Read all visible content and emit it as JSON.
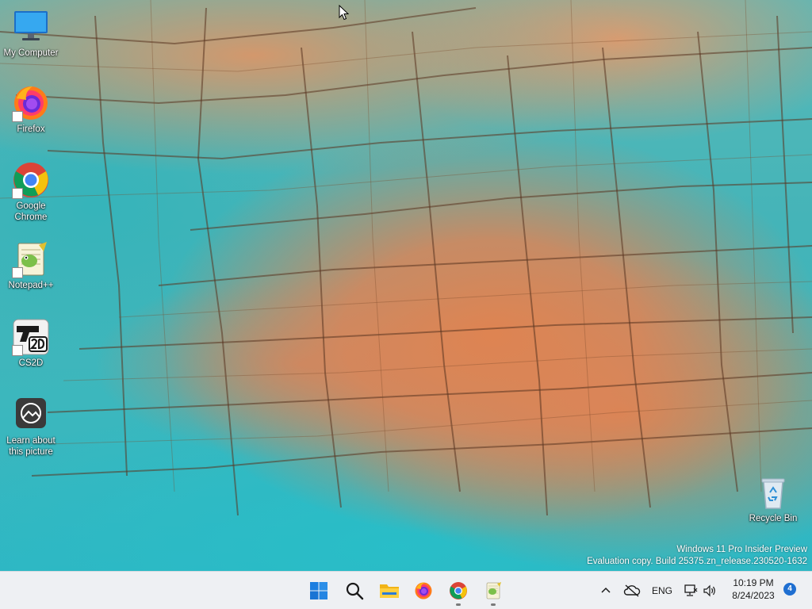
{
  "desktop": {
    "icons": [
      {
        "label": "My Computer"
      },
      {
        "label": "Firefox"
      },
      {
        "label": "Google\nChrome"
      },
      {
        "label": "Notepad++"
      },
      {
        "label": "CS2D"
      },
      {
        "label": "Learn about\nthis picture"
      },
      {
        "label": "Recycle Bin"
      }
    ],
    "watermark": {
      "line1": "Windows 11 Pro Insider Preview",
      "line2": "Evaluation copy. Build 25375.zn_release.230520-1632"
    }
  },
  "taskbar": {
    "apps": [
      {
        "icon": "windows-start-icon"
      },
      {
        "icon": "search-icon"
      },
      {
        "icon": "file-explorer-icon"
      },
      {
        "icon": "firefox-icon"
      },
      {
        "icon": "chrome-icon"
      },
      {
        "icon": "notepadpp-icon"
      }
    ],
    "tray": {
      "language": "ENG",
      "time": "10:19 PM",
      "date": "8/24/2023",
      "notification_count": "4"
    }
  },
  "colors": {
    "taskbar_bg": "#eef0f3",
    "accent": "#1f6fd1",
    "water": "#3cb7bd",
    "rock": "#e08250"
  }
}
